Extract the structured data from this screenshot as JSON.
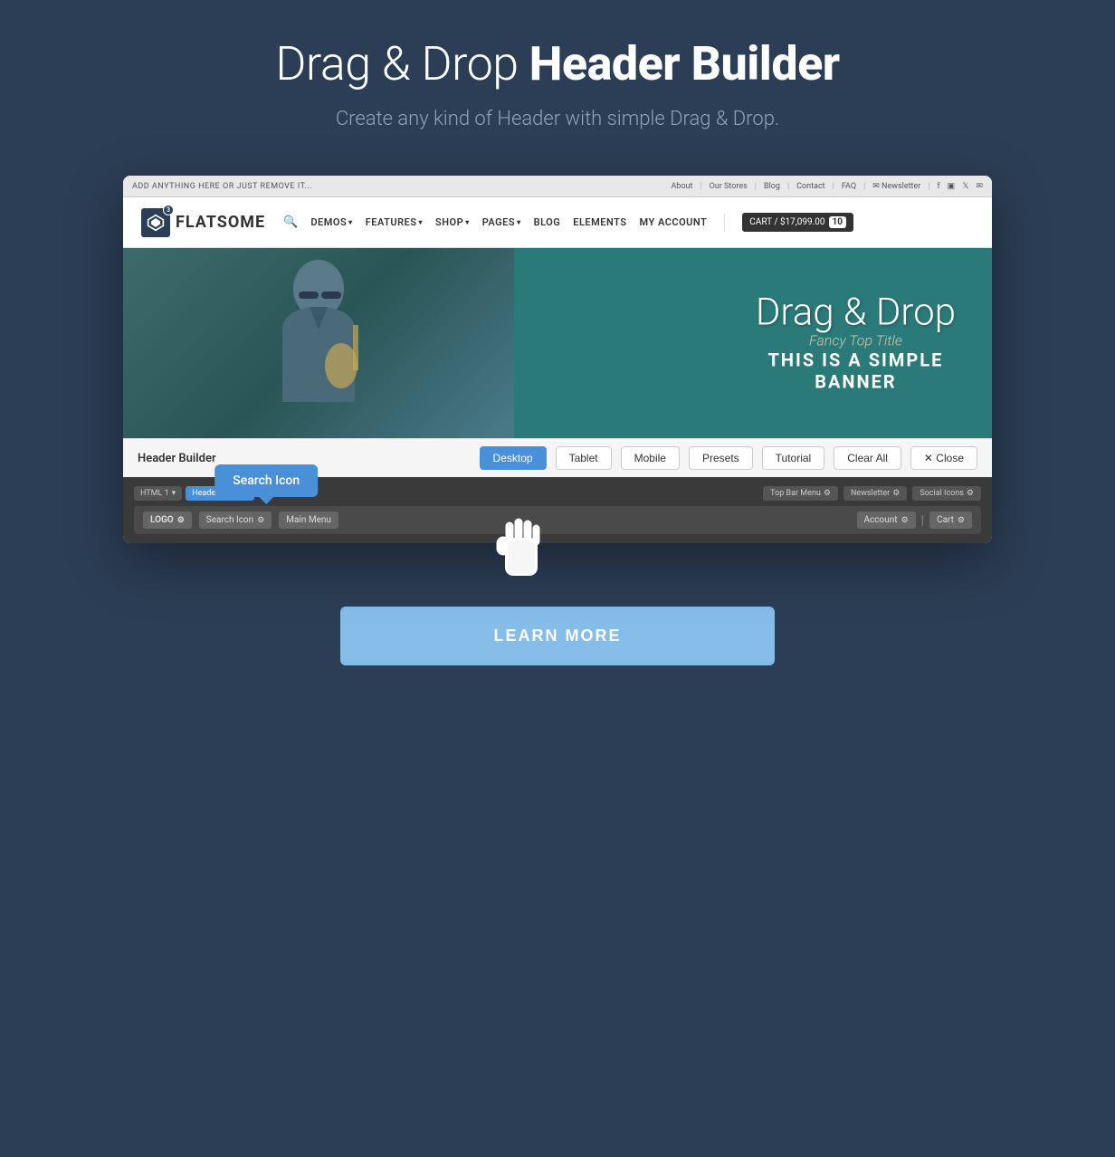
{
  "page": {
    "title": "Drag & Drop Header Builder",
    "title_normal": "Drag & Drop ",
    "title_bold": "Header Builder",
    "subtitle": "Create any kind of Header with simple Drag & Drop.",
    "learn_more_label": "LEARN MORE"
  },
  "browser": {
    "topbar": {
      "message": "ADD ANYTHING HERE OR JUST REMOVE IT...",
      "nav_items": [
        "About",
        "Our Stores",
        "Blog",
        "Contact",
        "FAQ",
        "Newsletter"
      ]
    },
    "site_header": {
      "logo_badge": "3",
      "logo_name": "FLATSOME",
      "nav_items": [
        "DEMOS",
        "FEATURES",
        "SHOP",
        "PAGES",
        "BLOG",
        "ELEMENTS",
        "MY ACCOUNT"
      ],
      "cart_label": "CART / $17,099.00",
      "cart_count": "10"
    },
    "banner": {
      "title": "Drag & Drop",
      "fancy_title": "Fancy Top Title",
      "subtitle": "THIS IS A SIMPLE\nBANNER"
    },
    "header_builder": {
      "title": "Header Builder",
      "tabs": [
        "Desktop",
        "Tablet",
        "Mobile"
      ],
      "active_tab": "Desktop",
      "buttons": [
        "Presets",
        "Tutorial",
        "Clear All",
        "× Close"
      ]
    },
    "builder": {
      "html_tag": "HTML 1",
      "header_main_tag": "Header Main",
      "top_bar_items": [
        "Top Bar Menu",
        "Newsletter",
        "Social Icons"
      ],
      "main_row": {
        "logo": "LOGO",
        "items": [
          "Search Icon",
          "Main Menu"
        ],
        "right_items": [
          "Account",
          "Cart"
        ]
      },
      "tooltip": "Search Icon"
    }
  }
}
